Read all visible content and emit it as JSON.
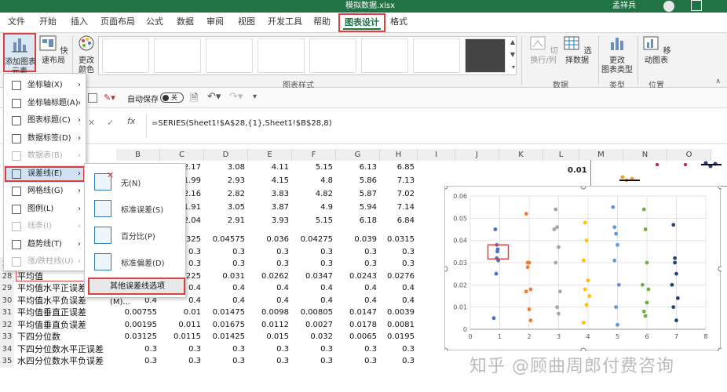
{
  "window": {
    "title": "模拟数据.xlsx",
    "user": "孟祥兵"
  },
  "tabs": [
    "文件",
    "开始",
    "插入",
    "页面布局",
    "公式",
    "数据",
    "审阅",
    "视图",
    "开发工具",
    "帮助",
    "图表设计",
    "格式"
  ],
  "ribbon": {
    "add_element": "添加图表\n元素",
    "quick_layout": "快速布局",
    "change_colors": "更改\n颜色",
    "chart_styles_label": "图表样式",
    "switch_row_col": "切换行/列",
    "select_data": "选择数据",
    "data_label": "数据",
    "change_type": "更改\n图表类型",
    "type_label": "类型",
    "move_chart": "移动图表",
    "location_label": "位置"
  },
  "qat": {
    "autosave": "自动保存",
    "toggle_state": "关"
  },
  "formula": "=SERIES(Sheet1!$A$28,{1},Sheet1!$B$28,8)",
  "columns": [
    "B",
    "C",
    "D",
    "E",
    "F",
    "G",
    "H",
    "I",
    "J",
    "K",
    "L",
    "M",
    "N",
    "O"
  ],
  "menu": {
    "items": [
      {
        "label": "坐标轴(X)",
        "arrow": "›",
        "disabled": false
      },
      {
        "label": "坐标轴标题(A)",
        "arrow": "›",
        "disabled": false
      },
      {
        "label": "图表标题(C)",
        "arrow": "›",
        "disabled": false
      },
      {
        "label": "数据标签(D)",
        "arrow": "›",
        "disabled": false
      },
      {
        "label": "数据表(B)",
        "arrow": "›",
        "disabled": true
      },
      {
        "label": "误差线(E)",
        "arrow": "›",
        "disabled": false
      },
      {
        "label": "网格线(G)",
        "arrow": "›",
        "disabled": false
      },
      {
        "label": "图例(L)",
        "arrow": "›",
        "disabled": false
      },
      {
        "label": "线条(I)",
        "arrow": "›",
        "disabled": true
      },
      {
        "label": "趋势线(T)",
        "arrow": "›",
        "disabled": false
      },
      {
        "label": "涨/跌柱线(U)",
        "arrow": "›",
        "disabled": true
      }
    ]
  },
  "submenu": {
    "items": [
      "无(N)",
      "标准误差(S)",
      "百分比(P)",
      "标准偏差(D)"
    ],
    "more": "其他误差线选项(M)..."
  },
  "top_rows": [
    [
      "2.17",
      "3.08",
      "4.11",
      "5.15",
      "6.13",
      "6.85"
    ],
    [
      "1.99",
      "2.93",
      "4.15",
      "4.8",
      "5.86",
      "7.13"
    ],
    [
      "2.16",
      "2.82",
      "3.83",
      "4.82",
      "5.87",
      "7.02"
    ],
    [
      "1.91",
      "3.05",
      "3.87",
      "4.9",
      "5.94",
      "7.14"
    ],
    [
      "2.04",
      "2.91",
      "3.93",
      "5.15",
      "6.18",
      "6.84"
    ]
  ],
  "rows": [
    {
      "num": "",
      "label": "",
      "b": "",
      "vals": [
        "0.0325",
        "0.04575",
        "0.036",
        "0.04275",
        "0.039",
        "0.0315"
      ]
    },
    {
      "num": "",
      "label": "",
      "b": "",
      "vals": [
        "0.3",
        "0.3",
        "0.3",
        "0.3",
        "0.3",
        "0.3"
      ]
    },
    {
      "num": "27",
      "label": "上四分位数水平误",
      "b": "",
      "vals": [
        "0.3",
        "0.3",
        "0.3",
        "0.3",
        "0.3",
        "0.3"
      ]
    },
    {
      "num": "28",
      "label": "平均值",
      "b": "",
      "vals": [
        "0.0225",
        "0.031",
        "0.0262",
        "0.0347",
        "0.0243",
        "0.0276"
      ]
    },
    {
      "num": "29",
      "label": "平均值水平正误差",
      "b": "",
      "vals": [
        "0.4",
        "0.4",
        "0.4",
        "0.4",
        "0.4",
        "0.4"
      ]
    },
    {
      "num": "30",
      "label": "平均值水平负误差",
      "b": "0.4",
      "vals": [
        "0.4",
        "0.4",
        "0.4",
        "0.4",
        "0.4",
        "0.4"
      ]
    },
    {
      "num": "31",
      "label": "平均值垂直正误差",
      "b": "0.00755",
      "vals": [
        "0.01",
        "0.01475",
        "0.0098",
        "0.00805",
        "0.0147",
        "0.0039"
      ]
    },
    {
      "num": "32",
      "label": "平均值垂直负误差",
      "b": "0.00195",
      "vals": [
        "0.011",
        "0.01675",
        "0.0112",
        "0.0027",
        "0.0178",
        "0.0081"
      ]
    },
    {
      "num": "33",
      "label": "下四分位数",
      "b": "0.03125",
      "vals": [
        "0.0115",
        "0.01425",
        "0.015",
        "0.032",
        "0.0065",
        "0.0195"
      ]
    },
    {
      "num": "34",
      "label": "下四分位数水平正误差",
      "b": "0.3",
      "vals": [
        "0.3",
        "0.3",
        "0.3",
        "0.3",
        "0.3",
        "0.3"
      ]
    },
    {
      "num": "35",
      "label": "水四分位数水平负误差",
      "b": "0.3",
      "vals": [
        "0.3",
        "0.3",
        "0.3",
        "0.3",
        "0.3",
        "0.3"
      ]
    }
  ],
  "mini_chart_label": "0.01",
  "chart_data": {
    "type": "scatter",
    "xlim": [
      0,
      8
    ],
    "ylim": [
      0,
      0.06
    ],
    "xticks": [
      "0",
      "1",
      "2",
      "3",
      "4",
      "5",
      "6",
      "7",
      "8"
    ],
    "yticks": [
      "0",
      "0.01",
      "0.02",
      "0.03",
      "0.04",
      "0.05",
      "0.06"
    ],
    "series": [
      {
        "color": "#4472c4",
        "x": [
          0.85,
          0.9,
          0.92,
          0.95,
          0.88,
          0.9,
          0.8,
          0.93
        ],
        "y": [
          0.045,
          0.038,
          0.035,
          0.031,
          0.025,
          0.032,
          0.005,
          0.036
        ]
      },
      {
        "color": "#ed7d31",
        "x": [
          1.9,
          2.0,
          1.95,
          2.05,
          1.9,
          2.0,
          2.05,
          1.95
        ],
        "y": [
          0.052,
          0.03,
          0.028,
          0.018,
          0.017,
          0.009,
          0.004,
          0.03
        ]
      },
      {
        "color": "#a5a5a5",
        "x": [
          2.9,
          2.95,
          3.0,
          2.9,
          3.05,
          2.95,
          3.0,
          2.85
        ],
        "y": [
          0.054,
          0.046,
          0.037,
          0.03,
          0.017,
          0.01,
          0.007,
          0.045
        ]
      },
      {
        "color": "#ffc000",
        "x": [
          3.9,
          3.95,
          3.85,
          4.0,
          3.9,
          3.95,
          3.85,
          4.05
        ],
        "y": [
          0.048,
          0.04,
          0.031,
          0.022,
          0.018,
          0.011,
          0.003,
          0.015
        ]
      },
      {
        "color": "#5b9bd5",
        "x": [
          4.85,
          4.9,
          4.95,
          5.0,
          4.9,
          5.05,
          4.95,
          5.0
        ],
        "y": [
          0.055,
          0.046,
          0.043,
          0.038,
          0.031,
          0.02,
          0.01,
          0.002
        ]
      },
      {
        "color": "#70ad47",
        "x": [
          5.9,
          5.95,
          6.0,
          5.85,
          6.05,
          5.9,
          5.95,
          6.0
        ],
        "y": [
          0.054,
          0.045,
          0.03,
          0.02,
          0.018,
          0.008,
          0.006,
          0.012
        ]
      },
      {
        "color": "#264478",
        "x": [
          6.9,
          6.95,
          7.0,
          6.85,
          7.05,
          6.9,
          7.0,
          6.95
        ],
        "y": [
          0.047,
          0.032,
          0.025,
          0.02,
          0.014,
          0.01,
          0.004,
          0.03
        ]
      }
    ]
  },
  "watermark": "知乎 @顾曲周郎付费咨询"
}
